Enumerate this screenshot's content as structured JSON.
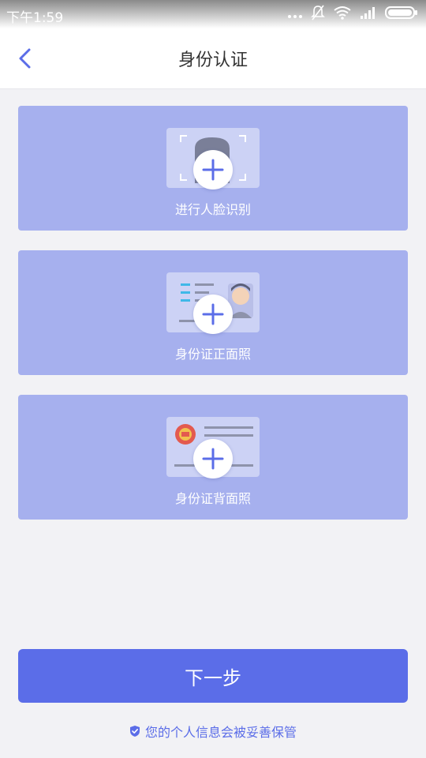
{
  "status_bar": {
    "time": "下午1:59",
    "icons": [
      "more-dots-icon",
      "bell-muted-icon",
      "wifi-icon",
      "signal-icon",
      "battery-icon"
    ]
  },
  "header": {
    "back_icon": "chevron-left-icon",
    "title": "身份认证"
  },
  "upload_cards": [
    {
      "label": "进行人脸识别",
      "icon": "face-scan-icon"
    },
    {
      "label": "身份证正面照",
      "icon": "id-card-front-icon"
    },
    {
      "label": "身份证背面照",
      "icon": "id-card-back-icon"
    }
  ],
  "footer": {
    "next_label": "下一步",
    "privacy_text": "您的个人信息会被妥善保管",
    "privacy_icon": "shield-check-icon"
  },
  "colors": {
    "accent": "#5b6de8",
    "card_bg": "#a6b0ee",
    "background": "#f2f2f5"
  }
}
